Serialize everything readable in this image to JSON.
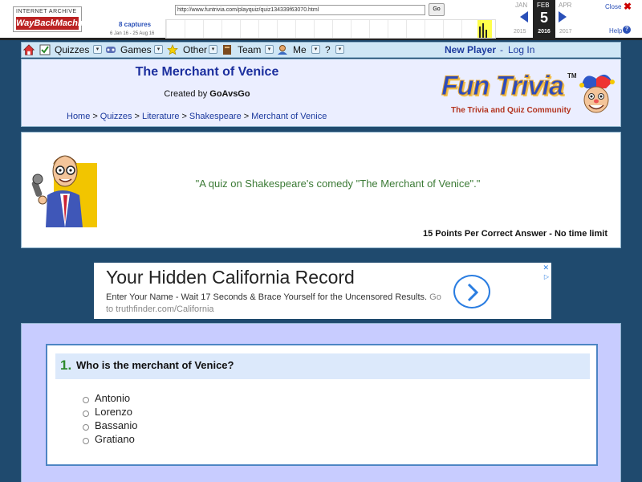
{
  "wayback": {
    "logo_top": "INTERNET ARCHIVE",
    "logo_main": "WayBackMachine",
    "url": "http://www.funtrivia.com/playquiz/quiz134339f63070.html",
    "go_label": "Go",
    "captures": "8 captures",
    "range": "6 Jan 16 - 25 Aug 16",
    "month_prev": "JAN",
    "month_cur": "FEB",
    "month_next": "APR",
    "day": "5",
    "year_prev": "2015",
    "year_cur": "2016",
    "year_next": "2017",
    "close_label": "Close",
    "help_label": "Help"
  },
  "nav": {
    "quizzes": "Quizzes",
    "games": "Games",
    "other": "Other",
    "team": "Team",
    "me": "Me",
    "help": "?",
    "new_player": "New Player",
    "separator": "-",
    "login": "Log In"
  },
  "header": {
    "title": "The Merchant of Venice",
    "created_prefix": "Created by",
    "author": "GoAvsGo",
    "breadcrumbs": [
      "Home",
      "Quizzes",
      "Literature",
      "Shakespeare",
      "Merchant of Venice"
    ],
    "crumb_sep": ">",
    "logo_text": "Fun Trivia",
    "logo_tm": "TM",
    "logo_tagline": "The Trivia and Quiz Community"
  },
  "intro": {
    "description": "\"A quiz on Shakespeare's comedy \"The Merchant of Venice\".\"",
    "points": "15 Points Per Correct Answer - No time limit"
  },
  "ad": {
    "title": "Your Hidden California Record",
    "body": "Enter Your Name - Wait 17 Seconds & Brace Yourself for the Uncensored Results.",
    "domain": "Go to truthfinder.com/California",
    "close": "✕",
    "adchoice": "▷"
  },
  "question": {
    "number": "1.",
    "text": "Who is the merchant of Venice?",
    "options": [
      "Antonio",
      "Lorenzo",
      "Bassanio",
      "Gratiano"
    ]
  },
  "colors": {
    "background": "#1f4a6e",
    "nav": "#cfe6f5",
    "header": "#ebeeff",
    "title": "#1c2f9e",
    "description": "#3b7a35",
    "quiz_bg": "#c8ccff",
    "question_number": "#2e8a2e"
  }
}
